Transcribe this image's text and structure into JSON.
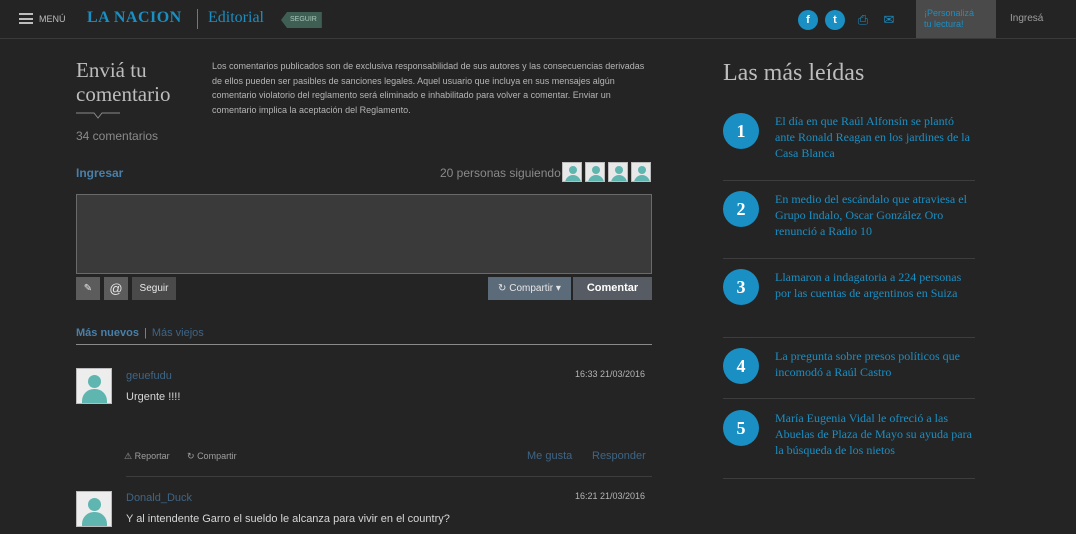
{
  "header": {
    "menu_label": "MENÚ",
    "logo": "LA NACION",
    "section": "Editorial",
    "seguir_tag": "SEGUIR",
    "personaliza": [
      "¡Personalizá",
      "tu lectura!"
    ],
    "login": "Ingresá",
    "social": {
      "facebook_glyph": "f",
      "twitter_glyph": "t",
      "print_glyph": "⎙",
      "mail_glyph": "✉"
    }
  },
  "comment_form": {
    "title_line1": "Enviá tu",
    "title_line2": "comentario",
    "count": "34 comentarios",
    "disclaimer": "Los comentarios publicados son de exclusiva responsabilidad de sus autores y las consecuencias derivadas de ellos pueden ser pasibles de sanciones legales. Aquel usuario que incluya en sus mensajes algún comentario violatorio del reglamento será eliminado e inhabilitado para volver a comentar. Enviar un comentario implica la aceptación del Reglamento.",
    "login_link": "Ingresar",
    "followers": "20 personas siguiendo",
    "textarea_value": "",
    "edit_glyph": "✎",
    "mention_glyph": "@",
    "follow_button": "Seguir",
    "share_button": "Compartir",
    "share_glyph": "↻",
    "submit_button": "Comentar"
  },
  "sort": {
    "newest": "Más nuevos",
    "separator": "|",
    "oldest": "Más viejos"
  },
  "comments": [
    {
      "user": "geuefudu",
      "date": "16:33 21/03/2016",
      "text": "Urgente !!!!",
      "report": "Reportar",
      "share": "Compartir",
      "like": "Me gusta",
      "reply": "Responder"
    },
    {
      "user": "Donald_Duck",
      "date": "16:21 21/03/2016",
      "text": "Y al intendente Garro el sueldo le alcanza para vivir en el country?"
    }
  ],
  "most_read": {
    "title": "Las más leídas",
    "items": [
      {
        "num": "1",
        "text": "El día en que Raúl Alfonsín se plantó ante Ronald Reagan en los jardines de la Casa Blanca"
      },
      {
        "num": "2",
        "text": "En medio del escándalo que atraviesa el Grupo Indalo, Oscar González Oro renunció a Radio 10"
      },
      {
        "num": "3",
        "text": "Llamaron a indagatoria a 224 personas por las cuentas de argentinos en Suiza"
      },
      {
        "num": "4",
        "text": "La pregunta sobre presos políticos que incomodó a Raúl Castro"
      },
      {
        "num": "5",
        "text": "María Eugenia Vidal le ofreció a las Abuelas de Plaza de Mayo su ayuda para la búsqueda de los nietos"
      }
    ]
  },
  "colors": {
    "accent": "#1a8fc4",
    "background": "#242424",
    "link_muted": "#3f6585"
  }
}
